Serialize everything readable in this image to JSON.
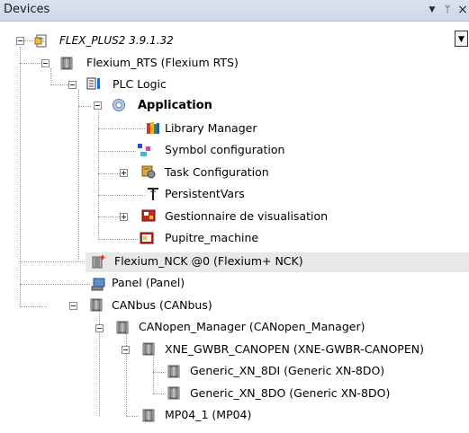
{
  "window": {
    "title": "Devices",
    "dropdown_glyph": "▼",
    "pin_glyph": "ᛘ",
    "close_glyph": "×",
    "side_button_glyph": "▼"
  },
  "tree": {
    "project": "FLEX_PLUS2 3.9.1.32",
    "flexium_rts": "Flexium_RTS (Flexium RTS)",
    "plc_logic": "PLC Logic",
    "application": "Application",
    "library_manager": "Library Manager",
    "symbol_configuration": "Symbol configuration",
    "task_configuration": "Task Configuration",
    "persistent_vars": "PersistentVars",
    "visualization_manager": "Gestionnaire de visualisation",
    "pupitre_machine": "Pupitre_machine",
    "flexium_nck": "Flexium_NCK @0  (Flexium+ NCK)",
    "panel": "Panel (Panel)",
    "canbus": "CANbus (CANbus)",
    "canopen_manager": "CANopen_Manager (CANopen_Manager)",
    "xne_gwbr": "XNE_GWBR_CANOPEN (XNE-GWBR-CANOPEN)",
    "generic_8di": "Generic_XN_8DI (Generic XN-8DO)",
    "generic_8do": "Generic_XN_8DO (Generic XN-8DO)",
    "mp04": "MP04_1 (MP04)"
  }
}
